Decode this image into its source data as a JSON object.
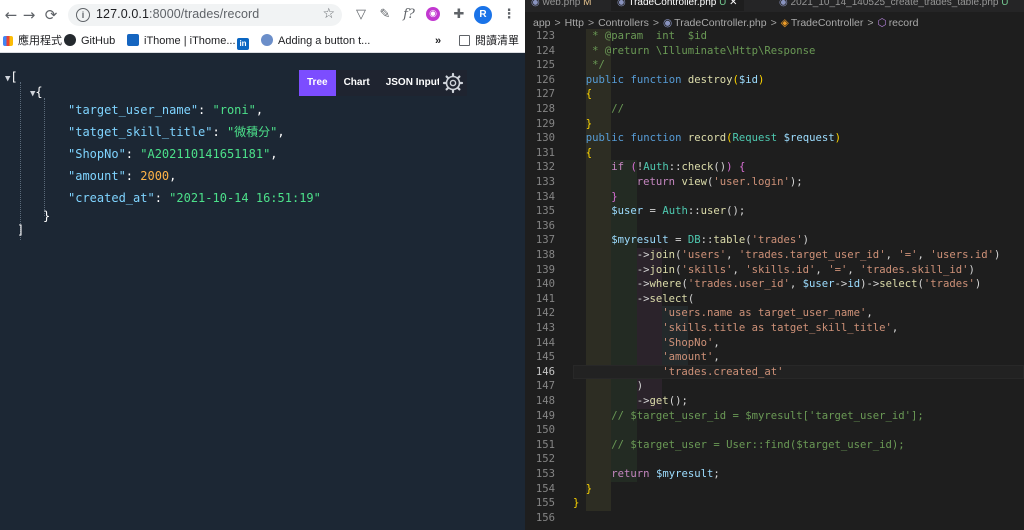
{
  "browser": {
    "url_host": "127.0.0.1",
    "url_rest": ":8000/trades/record",
    "profile_initial": "R",
    "bookmarks": [
      {
        "label": "應用程式",
        "icon": "apps-grid-icon"
      },
      {
        "label": "GitHub",
        "icon": "github-icon"
      },
      {
        "label": "iThome | iThome...",
        "icon": "ithome-icon"
      },
      {
        "label": "in",
        "icon": "linkedin-icon"
      },
      {
        "label": "Adding a button t...",
        "icon": "puzzle-gear-icon"
      }
    ],
    "reading_list": "閱讀清單",
    "more_bookmarks": "»"
  },
  "viewer": {
    "tabs": [
      "Tree",
      "Chart",
      "JSON Input"
    ],
    "active_tab": "Tree",
    "open_bracket": "[",
    "close_bracket": "]",
    "open_brace": "{",
    "close_brace": "}",
    "record": [
      {
        "key": "\"target_user_name\"",
        "value": "\"roni\"",
        "type": "string"
      },
      {
        "key": "\"tatget_skill_title\"",
        "value": "\"微積分\"",
        "type": "string"
      },
      {
        "key": "\"ShopNo\"",
        "value": "\"A202110141651181\"",
        "type": "string"
      },
      {
        "key": "\"amount\"",
        "value": "2000",
        "type": "number"
      },
      {
        "key": "\"created_at\"",
        "value": "\"2021-10-14 16:51:19\"",
        "type": "string"
      }
    ]
  },
  "editor": {
    "tabs": [
      {
        "label": "web.php",
        "badge": "M"
      },
      {
        "label": "TradeController.php",
        "badge": "U",
        "active": true
      },
      {
        "label": "2021_10_14_140525_create_trades_table.php",
        "badge": "U"
      }
    ],
    "breadcrumbs": [
      "app",
      ">",
      "Http",
      ">",
      "Controllers",
      ">",
      "TradeController.php",
      ">",
      "TradeController",
      ">",
      "record"
    ],
    "current_line": 146,
    "lines": [
      {
        "n": 123,
        "html": "   <span class='cm'>* @param  int  $id</span>"
      },
      {
        "n": 124,
        "html": "   <span class='cm'>* @return \\Illuminate\\Http\\Response</span>"
      },
      {
        "n": 125,
        "html": "   <span class='cm'>*/</span>"
      },
      {
        "n": 126,
        "html": "  <span class='kw'>public</span> <span class='kw'>function</span> <span class='fn'>destroy</span><span class='paren'>(</span><span class='var'>$id</span><span class='paren'>)</span>"
      },
      {
        "n": 127,
        "html": "  <span class='paren'>{</span>"
      },
      {
        "n": 128,
        "html": "      <span class='cm'>//</span>"
      },
      {
        "n": 129,
        "html": "  <span class='paren'>}</span>"
      },
      {
        "n": 130,
        "html": "  <span class='kw'>public</span> <span class='kw'>function</span> <span class='fn'>record</span><span class='paren'>(</span><span class='cls'>Request</span> <span class='var'>$request</span><span class='paren'>)</span>"
      },
      {
        "n": 131,
        "html": "  <span class='paren'>{</span>"
      },
      {
        "n": 132,
        "html": "      <span class='ctl'>if</span> <span class='brc'>(</span>!<span class='cls'>Auth</span>::<span class='fn'>check</span>()<span class='brc'>)</span> <span class='brc'>{</span>"
      },
      {
        "n": 133,
        "html": "          <span class='ctl'>return</span> <span class='fn'>view</span>(<span class='str'>'user.login'</span>);"
      },
      {
        "n": 134,
        "html": "      <span class='brc'>}</span>"
      },
      {
        "n": 135,
        "html": "      <span class='var'>$user</span> = <span class='cls'>Auth</span>::<span class='fn'>user</span>();"
      },
      {
        "n": 136,
        "html": ""
      },
      {
        "n": 137,
        "html": "      <span class='var'>$myresult</span> = <span class='cls'>DB</span>::<span class='fn'>table</span>(<span class='str'>'trades'</span>)"
      },
      {
        "n": 138,
        "html": "          -><span class='fn'>join</span>(<span class='str'>'users'</span>, <span class='str'>'trades.target_user_id'</span>, <span class='str'>'='</span>, <span class='str'>'users.id'</span>)"
      },
      {
        "n": 139,
        "html": "          -><span class='fn'>join</span>(<span class='str'>'skills'</span>, <span class='str'>'skills.id'</span>, <span class='str'>'='</span>, <span class='str'>'trades.skill_id'</span>)"
      },
      {
        "n": 140,
        "html": "          -><span class='fn'>where</span>(<span class='str'>'trades.user_id'</span>, <span class='var'>$user</span>-><span class='var'>id</span>)-><span class='fn'>select</span>(<span class='str'>'trades'</span>)"
      },
      {
        "n": 141,
        "html": "          -><span class='fn'>select</span>("
      },
      {
        "n": 142,
        "html": "              <span class='str'>'users.name as target_user_name'</span>,"
      },
      {
        "n": 143,
        "html": "              <span class='str'>'skills.title as tatget_skill_title'</span>,"
      },
      {
        "n": 144,
        "html": "              <span class='str'>'ShopNo'</span>,"
      },
      {
        "n": 145,
        "html": "              <span class='str'>'amount'</span>,"
      },
      {
        "n": 146,
        "html": "              <span class='str'>'trades.created_at'</span>"
      },
      {
        "n": 147,
        "html": "          )"
      },
      {
        "n": 148,
        "html": "          -><span class='fn'>get</span>();"
      },
      {
        "n": 149,
        "html": "      <span class='cm'>// $target_user_id = $myresult['target_user_id'];</span>"
      },
      {
        "n": 150,
        "html": ""
      },
      {
        "n": 151,
        "html": "      <span class='cm'>// $target_user = User::find($target_user_id);</span>"
      },
      {
        "n": 152,
        "html": ""
      },
      {
        "n": 153,
        "html": "      <span class='ctl'>return</span> <span class='var'>$myresult</span>;"
      },
      {
        "n": 154,
        "html": "  <span class='paren'>}</span>"
      },
      {
        "n": 155,
        "html": "<span class='paren'>}</span>"
      },
      {
        "n": 156,
        "html": ""
      }
    ]
  }
}
